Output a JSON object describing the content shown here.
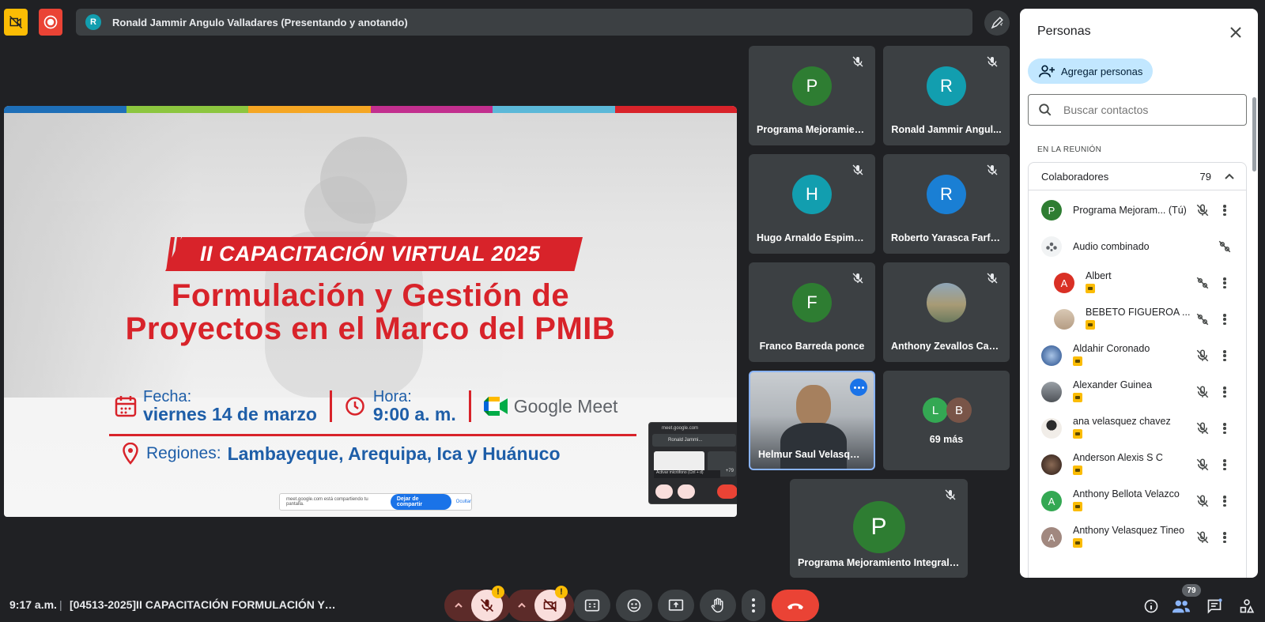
{
  "presenter": {
    "initial": "R",
    "label": "Ronald Jammir Angulo Valladares (Presentando y anotando)"
  },
  "slide": {
    "banner": "II CAPACITACIÓN VIRTUAL 2025",
    "title_line1": "Formulación y Gestión de",
    "title_line2": "Proyectos en el Marco del PMIB",
    "fecha_label": "Fecha:",
    "fecha_value": "viernes 14 de marzo",
    "hora_label": "Hora:",
    "hora_value": "9:00 a. m.",
    "meet_brand": "Google Meet",
    "regiones_label": "Regiones:",
    "regiones_value": "Lambayeque, Arequipa, Ica y Huánuco",
    "share_notice": "meet.google.com está compartiendo tu pantalla.",
    "share_stop": "Dejar de compartir",
    "share_hide": "Ocultar",
    "mini_url": "meet.google.com",
    "mini_presenter": "Ronald Jammi...",
    "mini_tooltip": "Activar micrófono (Ctrl + d)",
    "mini_count": "+79"
  },
  "tiles": [
    {
      "initial": "P",
      "color": "#2e7d32",
      "name": "Programa Mejoramien..."
    },
    {
      "initial": "R",
      "color": "#129eaf",
      "name": "Ronald Jammir Angul..."
    },
    {
      "initial": "H",
      "color": "#129eaf",
      "name": "Hugo Arnaldo Espimo ..."
    },
    {
      "initial": "R",
      "color": "#1a7fd4",
      "name": "Roberto Yarasca Farfan"
    },
    {
      "initial": "F",
      "color": "#2e7d32",
      "name": "Franco Barreda ponce"
    },
    {
      "initial": "",
      "color": "#6b7a5e",
      "name": "Anthony Zevallos Cac..."
    },
    {
      "initial": "",
      "color": "#5a6570",
      "name": "Helmur Saul Velasque..."
    },
    {
      "initial": "",
      "color": "#3c4043",
      "name": "69 más"
    },
    {
      "initial": "P",
      "color": "#2e7d32",
      "name": "Programa Mejoramiento Integral ..."
    }
  ],
  "more_avatars": [
    "L",
    "B"
  ],
  "people": {
    "title": "Personas",
    "add_label": "Agregar personas",
    "search_placeholder": "Buscar contactos",
    "section": "EN LA REUNIÓN",
    "group_label": "Colaboradores",
    "group_count": "79",
    "rows": [
      {
        "initial": "P",
        "color": "#2e7d32",
        "name": "Programa Mejoram...",
        "suffix": "(Tú)"
      },
      {
        "initial": "",
        "color": "#ffffff",
        "name": "Audio combinado",
        "suffix": ""
      },
      {
        "initial": "A",
        "color": "#d93025",
        "name": "Albert",
        "suffix": ""
      },
      {
        "initial": "",
        "color": "#c8b6a0",
        "name": "BEBETO FIGUEROA ...",
        "suffix": ""
      },
      {
        "initial": "",
        "color": "#7a9cc6",
        "name": "Aldahir Coronado",
        "suffix": ""
      },
      {
        "initial": "",
        "color": "#6b6f72",
        "name": "Alexander Guinea",
        "suffix": ""
      },
      {
        "initial": "",
        "color": "#e7e2dc",
        "name": "ana velasquez chavez",
        "suffix": ""
      },
      {
        "initial": "",
        "color": "#5a4034",
        "name": "Anderson Alexis S C",
        "suffix": ""
      },
      {
        "initial": "A",
        "color": "#34a853",
        "name": "Anthony Bellota Velazco",
        "suffix": ""
      },
      {
        "initial": "A",
        "color": "#a1887f",
        "name": "Anthony Velasquez Tineo",
        "suffix": ""
      }
    ]
  },
  "bottom": {
    "clock": "9:17 a.m.",
    "separator": "|",
    "meeting_title": "[04513-2025]II CAPACITACIÓN FORMULACIÓN Y G...",
    "people_count": "79",
    "warn_symbol": "!"
  }
}
